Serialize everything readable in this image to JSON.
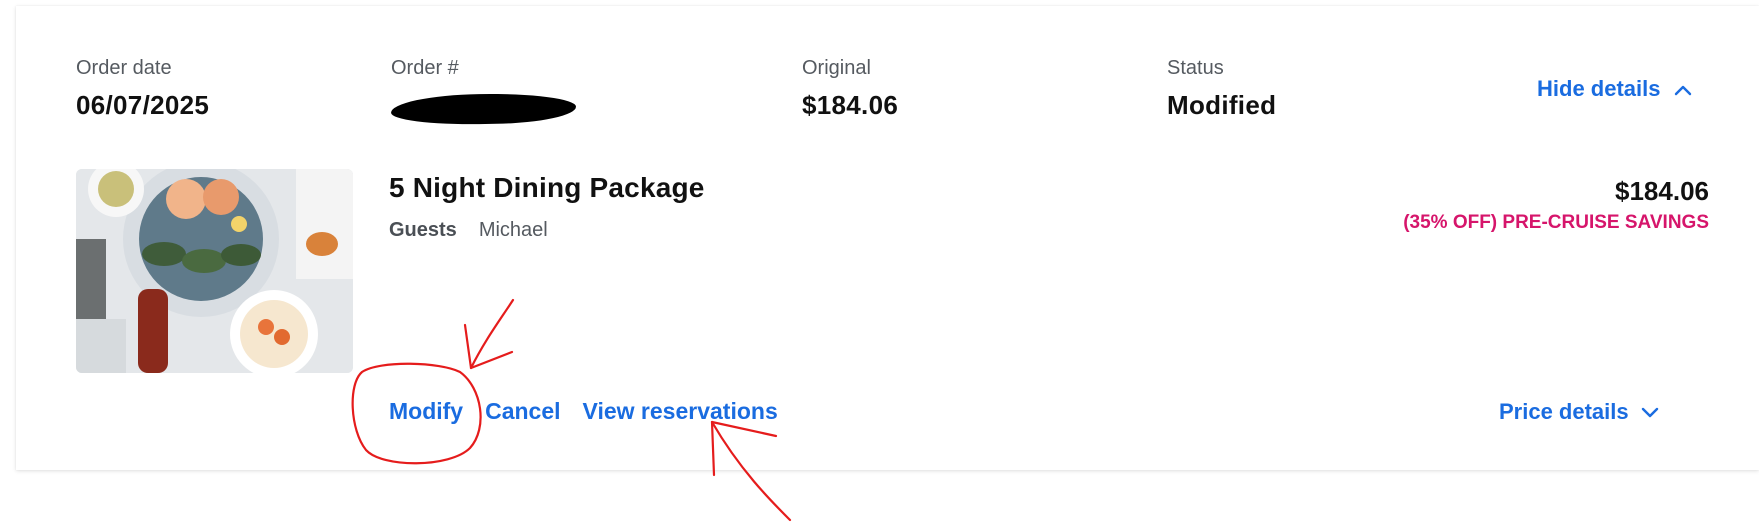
{
  "order_summary": {
    "order_date_label": "Order date",
    "order_date_value": "06/07/2025",
    "order_number_label": "Order #",
    "original_label": "Original",
    "original_value": "$184.06",
    "status_label": "Status",
    "status_value": "Modified",
    "hide_details_label": "Hide details",
    "hide_details_icon": "chevron-up-icon"
  },
  "item": {
    "title": "5 Night Dining Package",
    "guests_label": "Guests",
    "guests_value": "Michael",
    "price": "$184.06",
    "savings": "(35% OFF) PRE-CRUISE SAVINGS",
    "image_icon": "seafood-platter-image"
  },
  "actions": {
    "modify": "Modify",
    "cancel": "Cancel",
    "view_reservations": "View reservations",
    "price_details": "Price details",
    "price_details_icon": "chevron-down-icon"
  },
  "colors": {
    "link": "#1a6ce0",
    "savings": "#d6156b",
    "annotation": "#e51c1c"
  }
}
